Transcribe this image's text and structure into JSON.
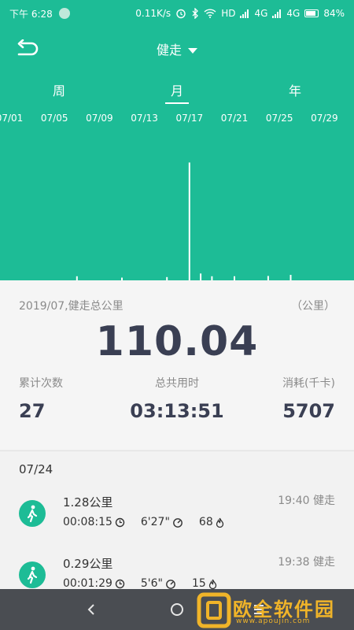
{
  "status_bar": {
    "time": "下午 6:28",
    "speed": "0.11K/s",
    "network": "HD",
    "signal1": "4G",
    "signal2": "4G",
    "battery": "84%",
    "battery_fraction": 0.84
  },
  "toolbar": {
    "title": "健走"
  },
  "tabs": [
    {
      "label": "周",
      "active": false
    },
    {
      "label": "月",
      "active": true
    },
    {
      "label": "年",
      "active": false
    }
  ],
  "chart_data": {
    "type": "bar",
    "categories": [
      "07/01",
      "07/05",
      "07/09",
      "07/13",
      "07/17",
      "07/21",
      "07/25",
      "07/29"
    ],
    "bars": [
      {
        "day": 7,
        "value": 1.5
      },
      {
        "day": 11,
        "value": 1.0
      },
      {
        "day": 15,
        "value": 1.2
      },
      {
        "day": 17,
        "value": 43.0
      },
      {
        "day": 18,
        "value": 2.5
      },
      {
        "day": 19,
        "value": 1.5
      },
      {
        "day": 21,
        "value": 1.5
      },
      {
        "day": 24,
        "value": 1.6
      },
      {
        "day": 26,
        "value": 2.0
      }
    ],
    "ylim": [
      0,
      50
    ]
  },
  "summary": {
    "caption": "2019/07,健走总公里",
    "unit": "（公里）",
    "total": "110.04",
    "stats": [
      {
        "label": "累计次数",
        "value": "27"
      },
      {
        "label": "总共用时",
        "value": "03:13:51"
      },
      {
        "label": "消耗(千卡)",
        "value": "5707"
      }
    ]
  },
  "records": {
    "date": "07/24",
    "items": [
      {
        "distance": "1.28公里",
        "duration": "00:08:15",
        "pace": "6'27\"",
        "calories": "68",
        "time": "19:40 健走"
      },
      {
        "distance": "0.29公里",
        "duration": "00:01:29",
        "pace": "5'6\"",
        "calories": "15",
        "time": "19:38 健走"
      }
    ]
  },
  "watermark": {
    "text": "欧全软件园",
    "url": "www.apoujin.com"
  },
  "colors": {
    "brand": "#1dbc96",
    "dark_text": "#3a3f53",
    "watermark": "#f0b429"
  }
}
